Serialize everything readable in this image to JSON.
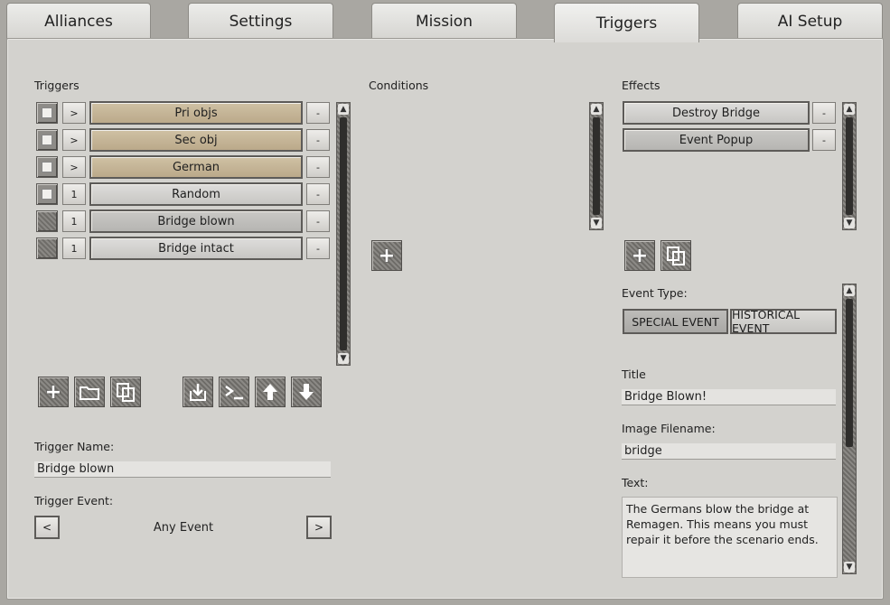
{
  "tabs": [
    {
      "label": "Alliances"
    },
    {
      "label": "Settings"
    },
    {
      "label": "Mission"
    },
    {
      "label": "Triggers",
      "active": true
    },
    {
      "label": "AI Setup"
    }
  ],
  "triggers": {
    "header": "Triggers",
    "rows": [
      {
        "mode": ">",
        "name": "Pri objs",
        "remove": "-"
      },
      {
        "mode": ">",
        "name": "Sec obj",
        "remove": "-"
      },
      {
        "mode": ">",
        "name": "German",
        "remove": "-"
      },
      {
        "mode": "1",
        "name": "Random",
        "remove": "-"
      },
      {
        "mode": "1",
        "name": "Bridge blown",
        "remove": "-"
      },
      {
        "mode": "1",
        "name": "Bridge intact",
        "remove": "-"
      }
    ],
    "name_label": "Trigger Name:",
    "name_value": "Bridge blown",
    "event_label": "Trigger Event:",
    "event_prev": "<",
    "event_value": "Any Event",
    "event_next": ">"
  },
  "conditions": {
    "header": "Conditions"
  },
  "effects": {
    "header": "Effects",
    "rows": [
      {
        "name": "Destroy Bridge",
        "remove": "-"
      },
      {
        "name": "Event Popup",
        "remove": "-"
      }
    ],
    "event_type_label": "Event Type:",
    "event_types": [
      "SPECIAL EVENT",
      "HISTORICAL EVENT"
    ],
    "title_label": "Title",
    "title_value": "Bridge Blown!",
    "image_label": "Image Filename:",
    "image_value": "bridge",
    "text_label": "Text:",
    "text_value": "The Germans blow the bridge at Remagen. This means you must repair it before the scenario ends."
  },
  "colors": {
    "tan_row": "#c7b796",
    "gray_row": "#d2d1ce",
    "panel": "#d3d2ce"
  }
}
